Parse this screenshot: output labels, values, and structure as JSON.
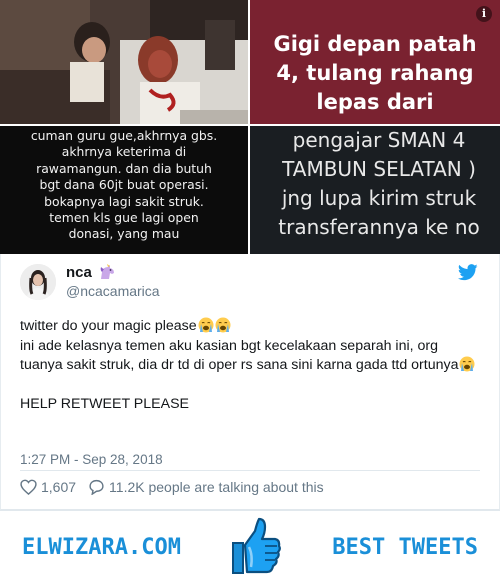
{
  "media": {
    "tile_top_right_lines": [
      "Gigi depan patah",
      "4, tulang rahang",
      "lepas dari"
    ],
    "tile_bottom_left_lines": [
      "cuman guru gue,akhrnya gbs.",
      "akhrnya keterima di",
      "rawamangun. dan dia butuh",
      "bgt dana 60jt buat operasi.",
      "bokapnya lagi sakit struk.",
      "temen kls gue lagi open",
      "donasi, yang mau"
    ],
    "tile_bottom_right_lines": [
      "pengajar SMAN 4",
      "TAMBUN SELATAN )",
      "jng lupa  kirim struk",
      "transferannya ke no"
    ],
    "info_icon_glyph": "i"
  },
  "tweet": {
    "name": "nca",
    "handle": "@ncacamarica",
    "text_line1": "twitter do your magic please",
    "text_block": "ini ade kelasnya temen aku kasian bgt kecelakaan separah ini, org tuanya sakit struk, dia dr td di oper rs sana sini karna gada ttd ortunya",
    "text_cta": "HELP RETWEET PLEASE",
    "timestamp": "1:27 PM - Sep 28, 2018",
    "like_count": "1,607",
    "talking_text": "11.2K people are talking about this"
  },
  "footer": {
    "left_text": "ELWIZARA.COM",
    "right_text": "BEST TWEETS"
  },
  "icons": {
    "info": "info-icon",
    "unicorn": "unicorn-icon",
    "twitter": "twitter-bird-icon",
    "crying": "crying-face-icon",
    "heart": "heart-icon",
    "reply": "speech-bubble-icon",
    "thumb": "thumbs-up-icon"
  },
  "colors": {
    "twitter_blue": "#1da1f2",
    "brand_blue": "#1a8fd8",
    "text_gray": "#657786"
  }
}
